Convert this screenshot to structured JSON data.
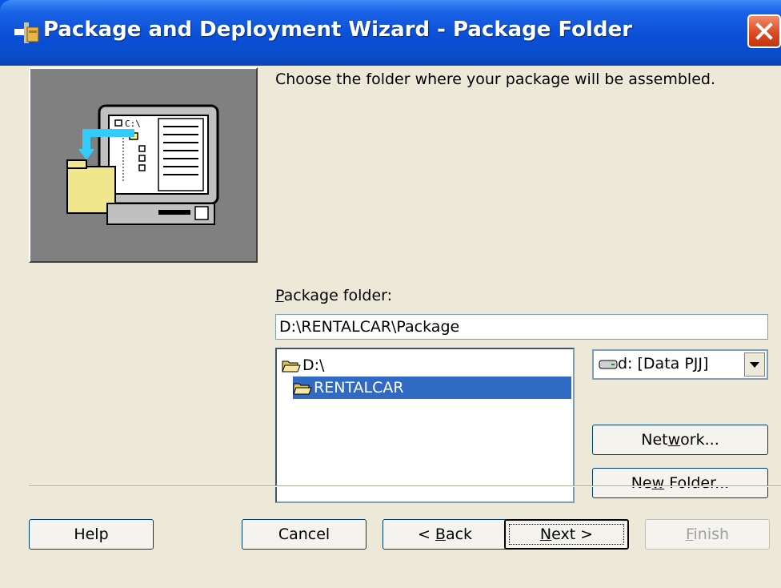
{
  "window": {
    "title": "Package and Deployment Wizard - Package Folder"
  },
  "content": {
    "instruction": "Choose the folder where your package will be assembled.",
    "package_folder_label_accel": "P",
    "package_folder_label_rest": "ackage folder:",
    "package_folder_value": "D:\\RENTALCAR\\Package",
    "image_label": "C:\\"
  },
  "folder_tree": {
    "items": [
      {
        "label": "D:\\",
        "selected": false
      },
      {
        "label": "RENTALCAR",
        "selected": true
      }
    ]
  },
  "drive_select": {
    "value": "d: [Data PJJ]"
  },
  "buttons": {
    "network_pre": "Net",
    "network_accel": "w",
    "network_post": "ork...",
    "new_folder_pre": "Ne",
    "new_folder_accel": "w",
    "new_folder_post": " Folder...",
    "help": "Help",
    "cancel": "Cancel",
    "back_pre": "< ",
    "back_accel": "B",
    "back_post": "ack",
    "next_accel": "N",
    "next_post": "ext >",
    "finish_accel": "F",
    "finish_post": "inish"
  },
  "colors": {
    "titlebar": "#0a4fd6",
    "selection": "#316ac5",
    "dialog_bg": "#ece9d8"
  }
}
